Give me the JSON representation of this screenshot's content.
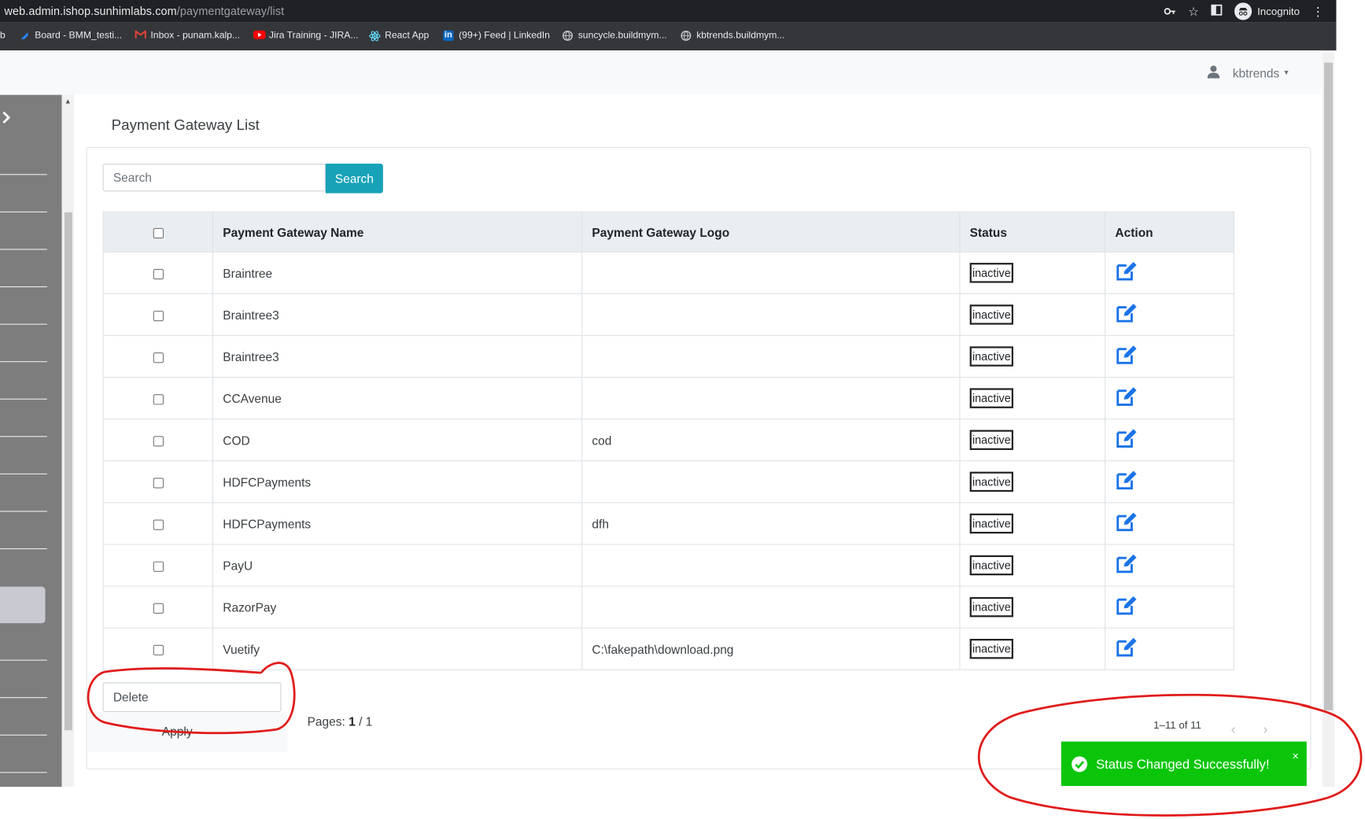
{
  "browser": {
    "url_host": "web.admin.ishop.sunhimlabs.com",
    "url_path": "/paymentgateway/list",
    "incognito_label": "Incognito",
    "bookmarks": [
      {
        "label": "b",
        "icon": "",
        "color": "#e8eaed"
      },
      {
        "label": "Board - BMM_testi...",
        "icon": "jira-icon",
        "color": "#2684ff"
      },
      {
        "label": "Inbox - punam.kalp...",
        "icon": "gmail-icon",
        "color": "#ea4335"
      },
      {
        "label": "Jira Training - JIRA...",
        "icon": "youtube-icon",
        "color": "#ff0000"
      },
      {
        "label": "React App",
        "icon": "react-icon",
        "color": "#61dafb"
      },
      {
        "label": "(99+) Feed | LinkedIn",
        "icon": "linkedin-icon",
        "color": "#0a66c2"
      },
      {
        "label": "suncycle.buildmym...",
        "icon": "globe-icon",
        "color": "#bdc1c6"
      },
      {
        "label": "kbtrends.buildmym...",
        "icon": "globe-icon",
        "color": "#bdc1c6"
      }
    ]
  },
  "header": {
    "user_name": "kbtrends"
  },
  "page": {
    "title": "Payment Gateway List",
    "search": {
      "placeholder": "Search",
      "button_label": "Search"
    },
    "table": {
      "columns": [
        "",
        "Payment Gateway Name",
        "Payment Gateway Logo",
        "Status",
        "Action"
      ],
      "rows": [
        {
          "name": "Braintree",
          "logo": "",
          "status": "inactive"
        },
        {
          "name": "Braintree3",
          "logo": "",
          "status": "inactive"
        },
        {
          "name": "Braintree3",
          "logo": "",
          "status": "inactive"
        },
        {
          "name": "CCAvenue",
          "logo": "",
          "status": "inactive"
        },
        {
          "name": "COD",
          "logo": "cod",
          "status": "inactive"
        },
        {
          "name": "HDFCPayments",
          "logo": "",
          "status": "inactive"
        },
        {
          "name": "HDFCPayments",
          "logo": "dfh",
          "status": "inactive"
        },
        {
          "name": "PayU",
          "logo": "",
          "status": "inactive"
        },
        {
          "name": "RazorPay",
          "logo": "",
          "status": "inactive"
        },
        {
          "name": "Vuetify",
          "logo": "C:\\fakepath\\download.png",
          "status": "inactive"
        }
      ]
    },
    "bulk_action": {
      "selected": "Delete",
      "apply_label": "Apply"
    },
    "pages": {
      "label": "Pages:",
      "current": "1",
      "total": "/ 1"
    },
    "pagination": {
      "range": "1–11 of 11"
    }
  },
  "toast": {
    "message": "Status Changed Successfully!",
    "close": "×",
    "color": "#0bc50b"
  },
  "colors": {
    "accent": "#17a2b8",
    "edit_icon": "#1a73e8",
    "annotation": "#e11b1b",
    "sidebar": "#7d7d7d"
  }
}
